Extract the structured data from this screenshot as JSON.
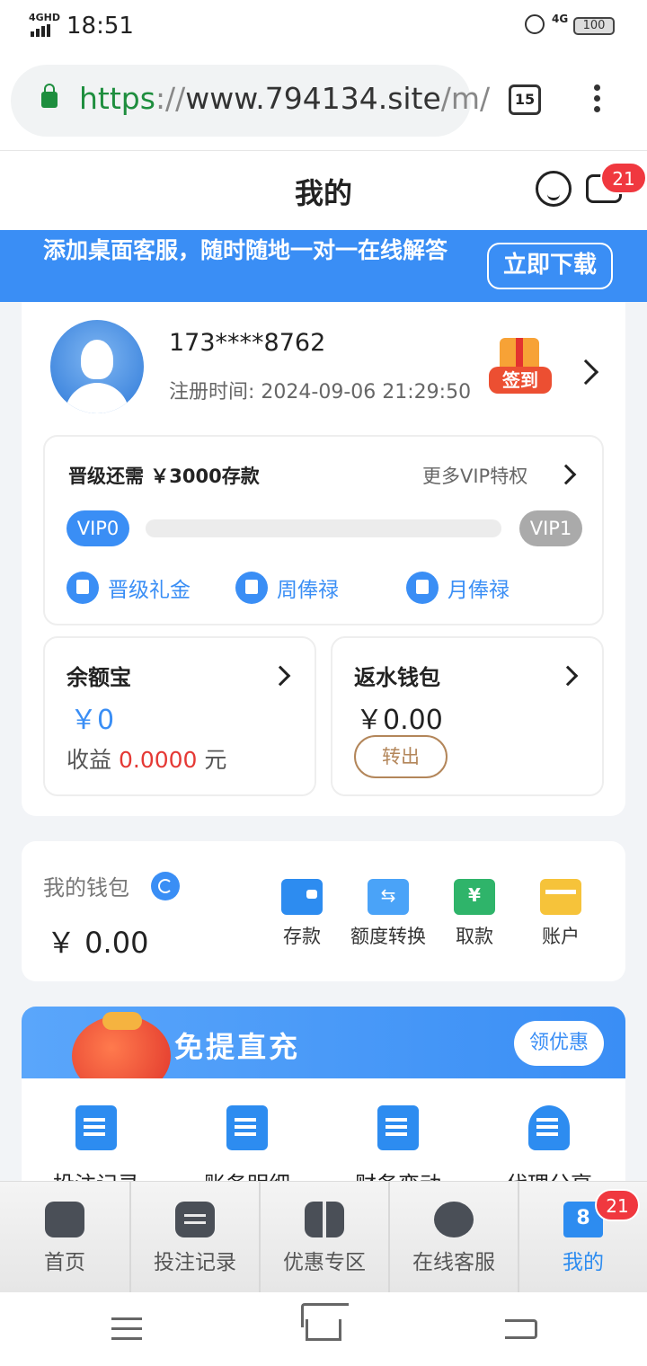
{
  "status_bar": {
    "network": "4GHD",
    "time": "18:51",
    "net_right": "4G",
    "battery": "100"
  },
  "browser": {
    "url_scheme": "https",
    "url_sep": "://",
    "url_host": "www.794134.site",
    "url_path": "/m/",
    "tab_count": "15"
  },
  "header": {
    "title": "我的",
    "message_badge": "21"
  },
  "banner": {
    "text": "添加桌面客服，随时随地一对一在线解答",
    "button": "立即下载"
  },
  "profile": {
    "phone": "173****8762",
    "register_label": "注册时间:",
    "register_time": "2024-09-06 21:29:50",
    "signin_label": "签到"
  },
  "vip": {
    "need_text": "晋级还需  ￥3000存款",
    "more_text": "更多VIP特权",
    "current": "VIP0",
    "next": "VIP1",
    "progress": 0,
    "perks": [
      "晋级礼金",
      "周俸禄",
      "月俸禄"
    ]
  },
  "yuebao": {
    "title": "余额宝",
    "value": "￥0",
    "earn_label": "收益",
    "earn_value": "0.0000",
    "earn_unit": "元"
  },
  "fanshui": {
    "title": "返水钱包",
    "value": "￥0.00",
    "button": "转出"
  },
  "wallet": {
    "title": "我的钱包",
    "value": "￥ 0.00",
    "actions": [
      {
        "label": "存款",
        "icon": "wallet-deposit-icon"
      },
      {
        "label": "额度转换",
        "icon": "transfer-icon"
      },
      {
        "label": "取款",
        "icon": "withdraw-icon"
      },
      {
        "label": "账户",
        "icon": "card-account-icon"
      }
    ]
  },
  "promo": {
    "title": "免提直充",
    "button": "领优惠"
  },
  "records": [
    {
      "label": "投注记录"
    },
    {
      "label": "账务明细"
    },
    {
      "label": "财务变动"
    },
    {
      "label": "代理分享"
    }
  ],
  "bottom_nav": {
    "items": [
      "首页",
      "投注记录",
      "优惠专区",
      "在线客服",
      "我的"
    ],
    "badge": "21",
    "active_color": "#2d8cf0"
  },
  "colors": {
    "accent": "#3a8ef5",
    "badge": "#f0383f",
    "earn": "#e53935",
    "transfer_btn": "#b3865a"
  }
}
